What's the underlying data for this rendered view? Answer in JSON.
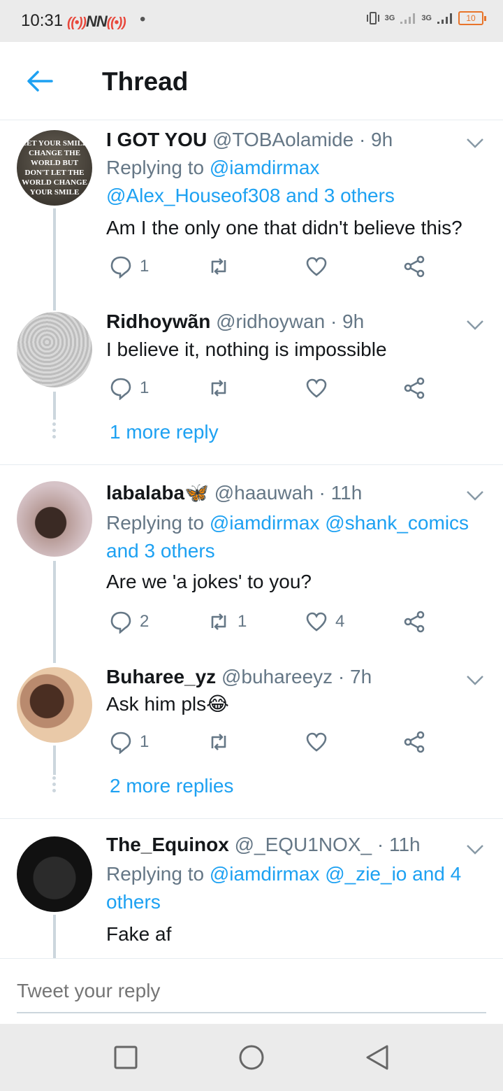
{
  "status": {
    "time": "10:31",
    "network_label_1": "3G",
    "network_label_2": "3G",
    "battery": "10"
  },
  "header": {
    "title": "Thread"
  },
  "tweets": [
    {
      "name": "I GOT YOU",
      "handle": "@TOBAolamide · 9h",
      "replying_prefix": "Replying to ",
      "replying_links": "@iamdirmax @Alex_Houseof308 and 3 others",
      "text": "Am I the only one that didn't believe this?",
      "replies": "1",
      "retweets": "",
      "likes": "",
      "avatar_text": "LET YOUR SMILE CHANGE THE WORLD BUT DON'T LET THE WORLD CHANGE YOUR SMILE"
    },
    {
      "name": "Ridhoywãn",
      "handle": "@ridhoywan · 9h",
      "text": "I believe it, nothing is impossible",
      "replies": "1",
      "retweets": "",
      "likes": ""
    },
    {
      "name": "labalaba🦋",
      "handle": "@haauwah · 11h",
      "replying_prefix": "Replying to ",
      "replying_links": "@iamdirmax @shank_comics and 3 others",
      "text": "Are we 'a jokes' to you?",
      "replies": "2",
      "retweets": "1",
      "likes": "4"
    },
    {
      "name": "Buharee_yz",
      "handle": "@buhareeyz · 7h",
      "text": "Ask him pls😂",
      "replies": "1",
      "retweets": "",
      "likes": ""
    },
    {
      "name": "The_Equinox",
      "handle": "@_EQU1NOX_ · 11h",
      "replying_prefix": "Replying to ",
      "replying_links": "@iamdirmax @_zie_io and 4 others",
      "text": "Fake af"
    }
  ],
  "more_replies": [
    "1 more reply",
    "2 more replies"
  ],
  "composer": {
    "placeholder": "Tweet your reply"
  },
  "colors": {
    "accent": "#1da1f2",
    "secondary_text": "#657786",
    "divider": "#e6ecf0"
  },
  "icons": [
    "back-arrow-icon",
    "chevron-down-icon",
    "reply-icon",
    "retweet-icon",
    "like-icon",
    "share-icon",
    "nav-square-icon",
    "nav-circle-icon",
    "nav-triangle-icon"
  ]
}
